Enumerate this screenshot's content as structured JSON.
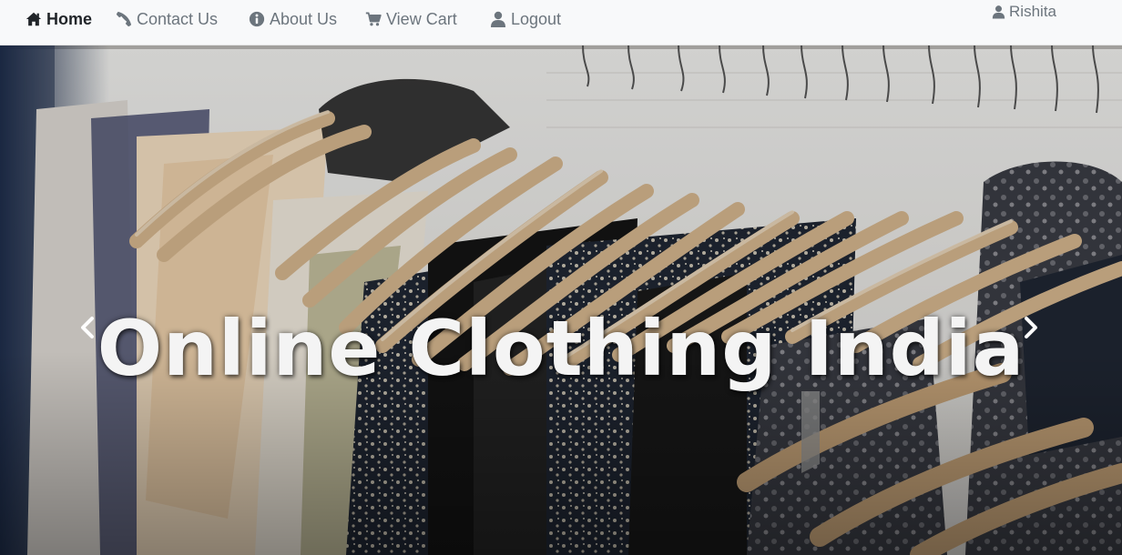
{
  "nav": {
    "items": [
      {
        "label": "Home",
        "icon": "home-icon",
        "active": true
      },
      {
        "label": "Contact Us",
        "icon": "phone-icon",
        "active": false
      },
      {
        "label": "About Us",
        "icon": "info-circle-icon",
        "active": false
      },
      {
        "label": "View Cart",
        "icon": "cart-icon",
        "active": false
      },
      {
        "label": "Logout",
        "icon": "user-icon",
        "active": false
      }
    ],
    "user": {
      "name": "Rishita",
      "icon": "user-icon"
    }
  },
  "hero": {
    "title": "Online Clothing India",
    "prev_icon": "chevron-left-icon",
    "next_icon": "chevron-right-icon"
  },
  "colors": {
    "navbar_bg": "#f8f9fa",
    "nav_active": "#212529",
    "nav_text": "#6c757d",
    "title_text": "#f4f4f4"
  }
}
